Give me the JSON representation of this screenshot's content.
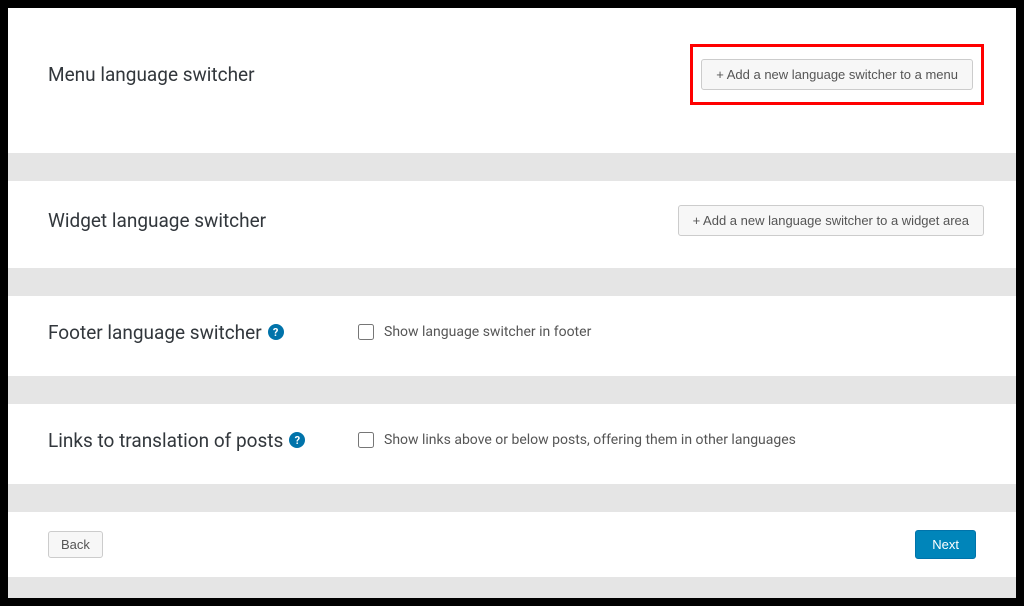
{
  "sections": {
    "menu": {
      "title": "Menu language switcher",
      "button_label": "+ Add a new language switcher to a menu"
    },
    "widget": {
      "title": "Widget language switcher",
      "button_label": "+ Add a new language switcher to a widget area"
    },
    "footer": {
      "title": "Footer language switcher",
      "checkbox_label": "Show language switcher in footer"
    },
    "links": {
      "title": "Links to translation of posts",
      "checkbox_label": "Show links above or below posts, offering them in other languages"
    }
  },
  "nav": {
    "back_label": "Back",
    "next_label": "Next"
  },
  "icons": {
    "help": "?"
  }
}
